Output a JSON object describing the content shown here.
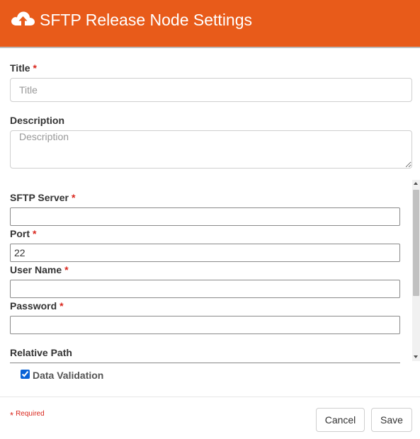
{
  "header": {
    "title": "SFTP Release Node Settings",
    "icon": "cloud-upload-icon",
    "background": "#e85b1a"
  },
  "form": {
    "title": {
      "label": "Title",
      "required_mark": "*",
      "placeholder": "Title",
      "value": ""
    },
    "description": {
      "label": "Description",
      "placeholder": "Description",
      "value": ""
    },
    "sftp_server": {
      "label": "SFTP Server",
      "required_mark": "*",
      "value": ""
    },
    "port": {
      "label": "Port",
      "required_mark": "*",
      "value": "22"
    },
    "user_name": {
      "label": "User Name",
      "required_mark": "*",
      "value": ""
    },
    "password": {
      "label": "Password",
      "required_mark": "*",
      "value": ""
    },
    "relative_path": {
      "label": "Relative Path",
      "value": ""
    },
    "data_validation": {
      "label": "Data Validation",
      "checked": true
    }
  },
  "footer": {
    "required_mark": "*",
    "required_text": "Required",
    "cancel_label": "Cancel",
    "save_label": "Save"
  },
  "colors": {
    "accent": "#e85b1a",
    "required": "#d9261c",
    "checkbox": "#0a63d6"
  }
}
